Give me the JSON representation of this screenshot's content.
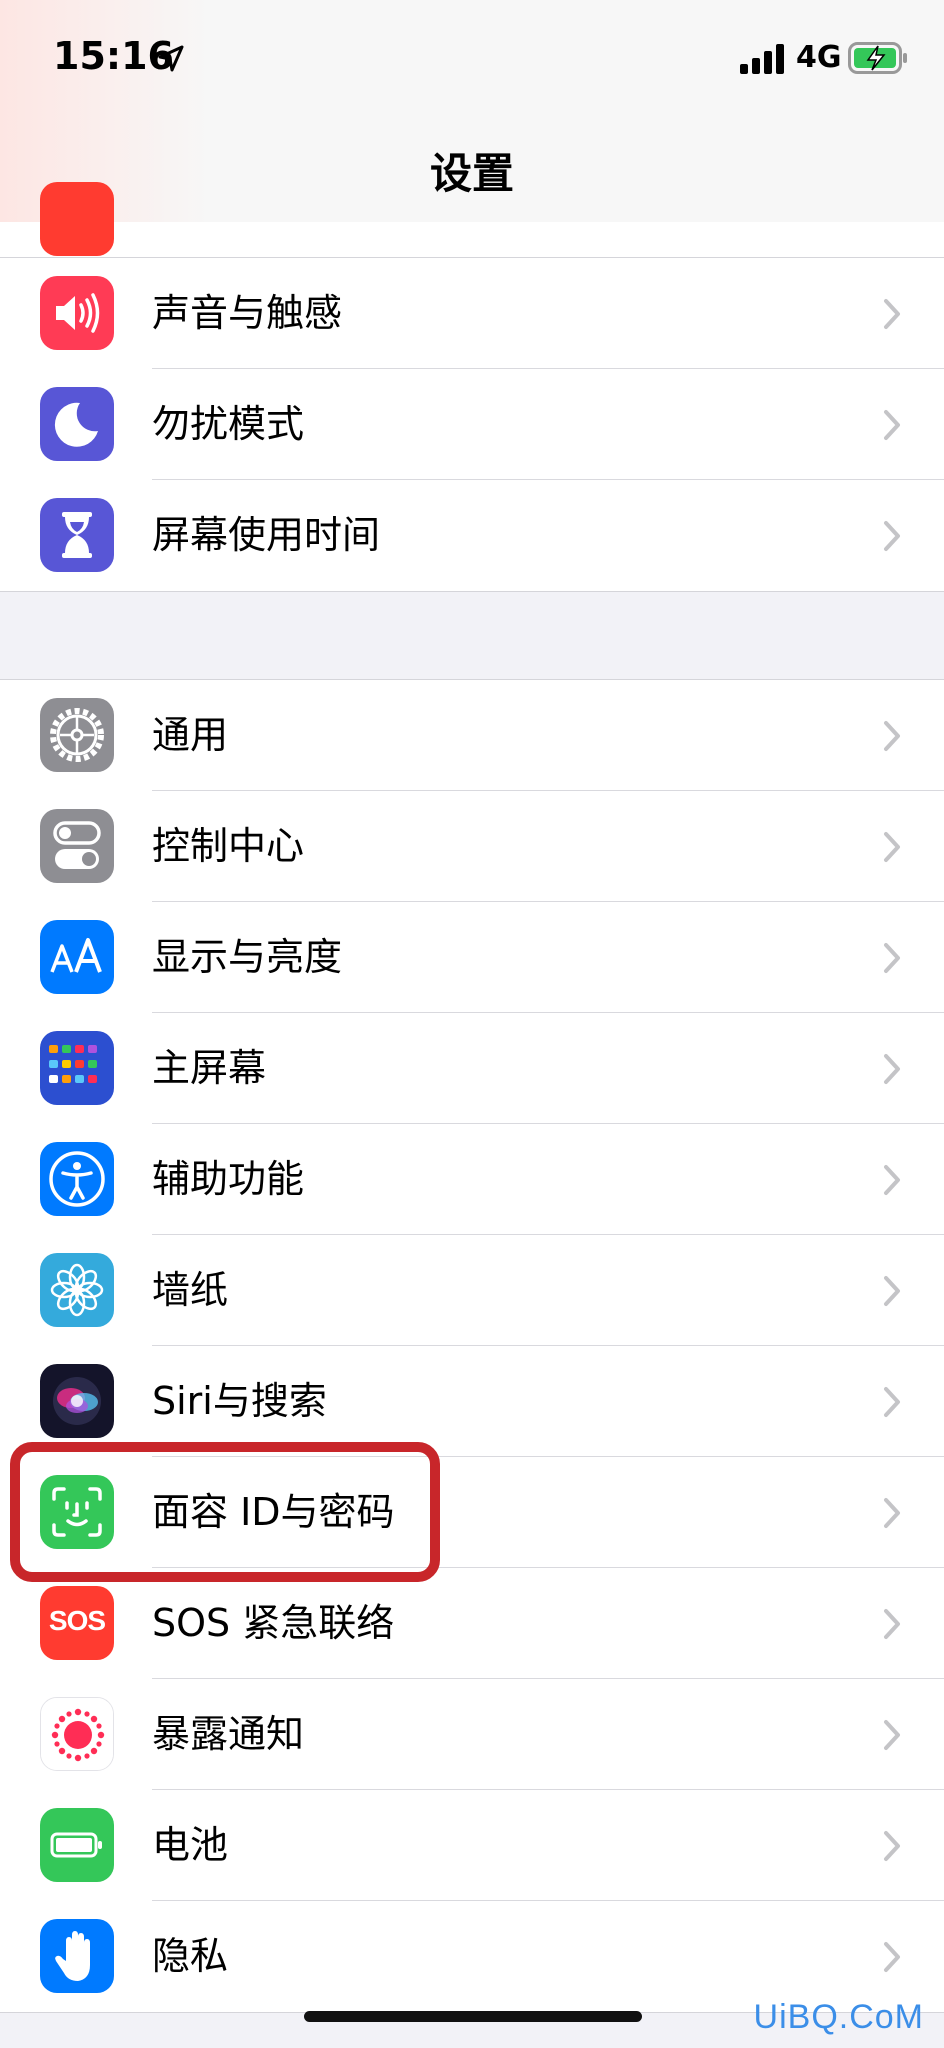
{
  "status_bar": {
    "time": "15:16",
    "carrier": "4G",
    "icons": [
      "location-arrow-icon",
      "cellular-signal-icon",
      "battery-charging-icon"
    ]
  },
  "nav": {
    "title": "设置"
  },
  "groups": [
    {
      "items": [
        {
          "label": "声音与触感",
          "icon": "speaker-icon",
          "color": "#ff3b55"
        },
        {
          "label": "勿扰模式",
          "icon": "moon-icon",
          "color": "#5856d6"
        },
        {
          "label": "屏幕使用时间",
          "icon": "hourglass-icon",
          "color": "#5856d6"
        }
      ]
    },
    {
      "items": [
        {
          "label": "通用",
          "icon": "gear-icon",
          "color": "#8e8e93"
        },
        {
          "label": "控制中心",
          "icon": "toggles-icon",
          "color": "#8e8e93"
        },
        {
          "label": "显示与亮度",
          "icon": "text-size-icon",
          "color": "#007aff"
        },
        {
          "label": "主屏幕",
          "icon": "home-screen-grid-icon",
          "color": "#2c5bd6"
        },
        {
          "label": "辅助功能",
          "icon": "accessibility-icon",
          "color": "#007aff"
        },
        {
          "label": "墙纸",
          "icon": "flower-icon",
          "color": "#34aadc"
        },
        {
          "label": "Siri与搜索",
          "icon": "siri-icon",
          "color": "#1c1c2e"
        },
        {
          "label": "面容 ID与密码",
          "icon": "face-id-icon",
          "color": "#34c759"
        },
        {
          "label": "SOS 紧急联络",
          "icon": "sos-icon",
          "color": "#ff3b30",
          "icon_text": "SOS"
        },
        {
          "label": "暴露通知",
          "icon": "exposure-notification-icon",
          "color": "#ff2d55"
        },
        {
          "label": "电池",
          "icon": "battery-icon",
          "color": "#34c759"
        },
        {
          "label": "隐私",
          "icon": "hand-icon",
          "color": "#007aff"
        }
      ]
    }
  ],
  "accent_colors": {
    "highlight_box": "#c8262a",
    "watermark": "#3b8ee8"
  },
  "watermark": "UiBQ.CoM"
}
